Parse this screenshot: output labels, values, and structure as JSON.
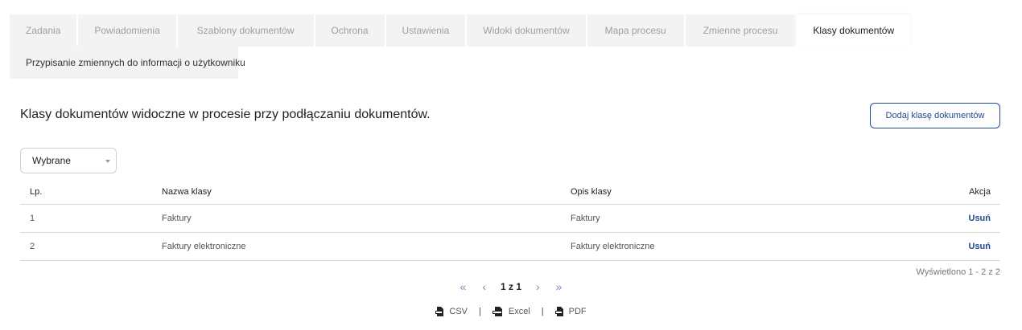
{
  "tabs": [
    {
      "label": "Zadania",
      "active": false
    },
    {
      "label": "Powiadomienia",
      "active": false
    },
    {
      "label": "Szablony dokumentów",
      "active": false
    },
    {
      "label": "Ochrona",
      "active": false
    },
    {
      "label": "Ustawienia",
      "active": false
    },
    {
      "label": "Widoki dokumentów",
      "active": false
    },
    {
      "label": "Mapa procesu",
      "active": false
    },
    {
      "label": "Zmienne procesu",
      "active": false
    },
    {
      "label": "Klasy dokumentów",
      "active": true
    },
    {
      "label": "Przypisanie zmiennych do informacji o użytkowniku",
      "active": false
    }
  ],
  "section": {
    "title": "Klasy dokumentów widoczne w procesie przy podłączaniu dokumentów.",
    "add_button": "Dodaj klasę dokumentów"
  },
  "filter": {
    "selected": "Wybrane"
  },
  "table": {
    "headers": [
      "Lp.",
      "Nazwa klasy",
      "Opis klasy",
      "Akcja"
    ],
    "rows": [
      {
        "lp": "1",
        "name": "Faktury",
        "desc": "Faktury",
        "action": "Usuń"
      },
      {
        "lp": "2",
        "name": "Faktury elektroniczne",
        "desc": "Faktury elektroniczne",
        "action": "Usuń"
      }
    ]
  },
  "summary": "Wyświetlono 1 - 2 z 2",
  "pagination": {
    "first": "«",
    "prev": "‹",
    "info": "1 z 1",
    "next": "›",
    "last": "»"
  },
  "exports": [
    {
      "label": "CSV",
      "icon": "csv-file-icon"
    },
    {
      "label": "Excel",
      "icon": "excel-file-icon"
    },
    {
      "label": "PDF",
      "icon": "pdf-file-icon"
    }
  ],
  "export_separator": "|",
  "colors": {
    "accent": "#1e4b8f",
    "tab_bg": "#f3f3f4",
    "border": "#d8d8d8"
  }
}
